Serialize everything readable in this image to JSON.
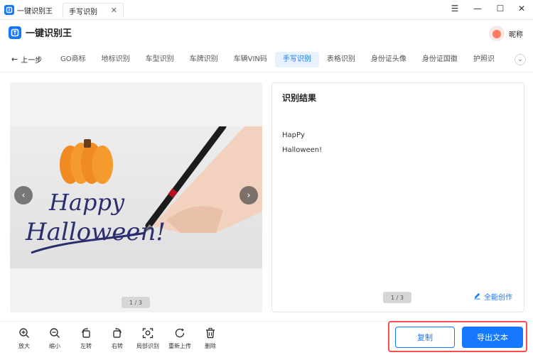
{
  "titlebar": {
    "app_name": "一键识别王",
    "doc_tab": "手写识别",
    "close_glyph": "✕",
    "controls": [
      "☰",
      "—",
      "☐",
      "✕"
    ]
  },
  "header": {
    "brand": "一键识别王",
    "user_name": "昵称"
  },
  "nav": {
    "back_label": "上一步",
    "items": [
      "GO商标",
      "地标识别",
      "车型识别",
      "车牌识别",
      "车辆VIN码",
      "手写识别",
      "表格识别",
      "身份证头像",
      "身份证国徽",
      "护照识"
    ],
    "active_index": 5,
    "more_glyph": "⌄"
  },
  "image_panel": {
    "prev_glyph": "‹",
    "next_glyph": "›",
    "page_indicator": "1 / 3",
    "handwriting_line1": "Happy",
    "handwriting_line2": "Halloween!"
  },
  "result_panel": {
    "title": "识别结果",
    "lines": [
      "HapPy",
      "Halloween!"
    ],
    "page_indicator": "1 / 3",
    "ai_create_label": "全能创作"
  },
  "toolbar": {
    "tools": [
      {
        "icon": "zoom-in-icon",
        "label": "放大"
      },
      {
        "icon": "zoom-out-icon",
        "label": "缩小"
      },
      {
        "icon": "rotate-left-icon",
        "label": "左转"
      },
      {
        "icon": "rotate-right-icon",
        "label": "右转"
      },
      {
        "icon": "scan-region-icon",
        "label": "局部识别"
      },
      {
        "icon": "reupload-icon",
        "label": "重新上传"
      },
      {
        "icon": "trash-icon",
        "label": "删除"
      }
    ],
    "copy_label": "复制",
    "export_label": "导出文本"
  },
  "colors": {
    "accent": "#1677ff",
    "highlight_border": "#ff4d4f"
  }
}
